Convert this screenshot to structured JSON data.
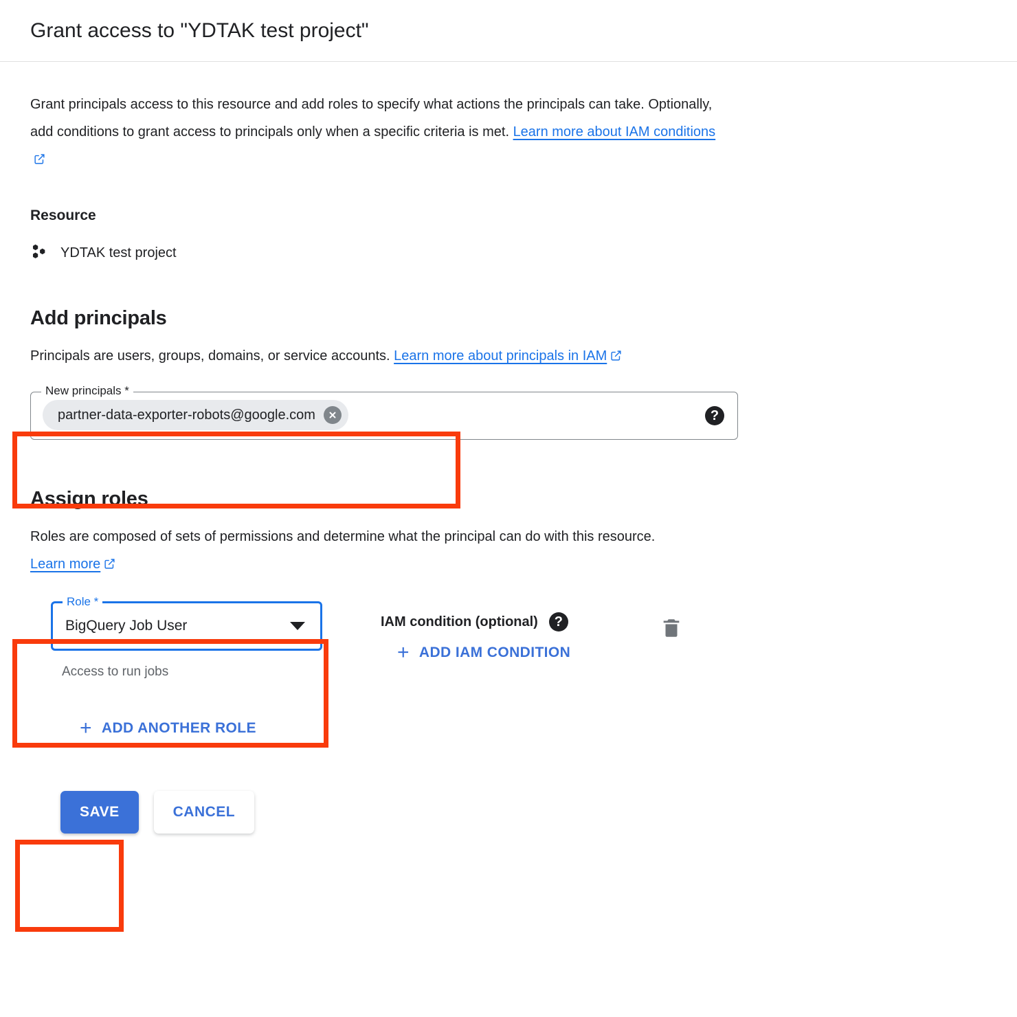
{
  "dialog": {
    "title": "Grant access to \"YDTAK test project\"",
    "intro_part1": "Grant principals access to this resource and add roles to specify what actions the principals can take. Optionally, add conditions to grant access to principals only when a specific criteria is met. ",
    "intro_link": "Learn more about IAM conditions"
  },
  "resource": {
    "heading": "Resource",
    "icon": "project-hexagons-icon",
    "name": "YDTAK test project"
  },
  "principals": {
    "heading": "Add principals",
    "desc_part1": "Principals are users, groups, domains, or service accounts. ",
    "desc_link": "Learn more about principals in IAM",
    "field_label": "New principals *",
    "chip_value": "partner-data-exporter-robots@google.com",
    "chip_remove_icon": "close-circle-icon",
    "help_icon": "help-icon",
    "placeholder": ""
  },
  "roles": {
    "heading": "Assign roles",
    "desc_part1": "Roles are composed of sets of permissions and determine what the principal can do with this resource. ",
    "desc_link": "Learn more",
    "role_label": "Role *",
    "role_value": "BigQuery Job User",
    "role_hint": "Access to run jobs",
    "caret_icon": "chevron-down-icon",
    "iam_condition_label": "IAM condition (optional)",
    "iam_help_icon": "help-icon",
    "add_iam_condition_label": "ADD IAM CONDITION",
    "delete_icon": "trash-icon",
    "add_another_role_label": "ADD ANOTHER ROLE",
    "plus_icon": "plus-icon"
  },
  "actions": {
    "save_label": "SAVE",
    "cancel_label": "CANCEL"
  },
  "colors": {
    "link_blue": "#1a73e8",
    "button_blue": "#3b71d8",
    "annotation_red": "#f93b0c",
    "focus_blue": "#1a73e8",
    "hint_gray": "#5f6368"
  },
  "annotations": [
    {
      "name": "new-principals-field",
      "label": ""
    },
    {
      "name": "role-select",
      "label": ""
    },
    {
      "name": "save-button",
      "label": ""
    }
  ]
}
